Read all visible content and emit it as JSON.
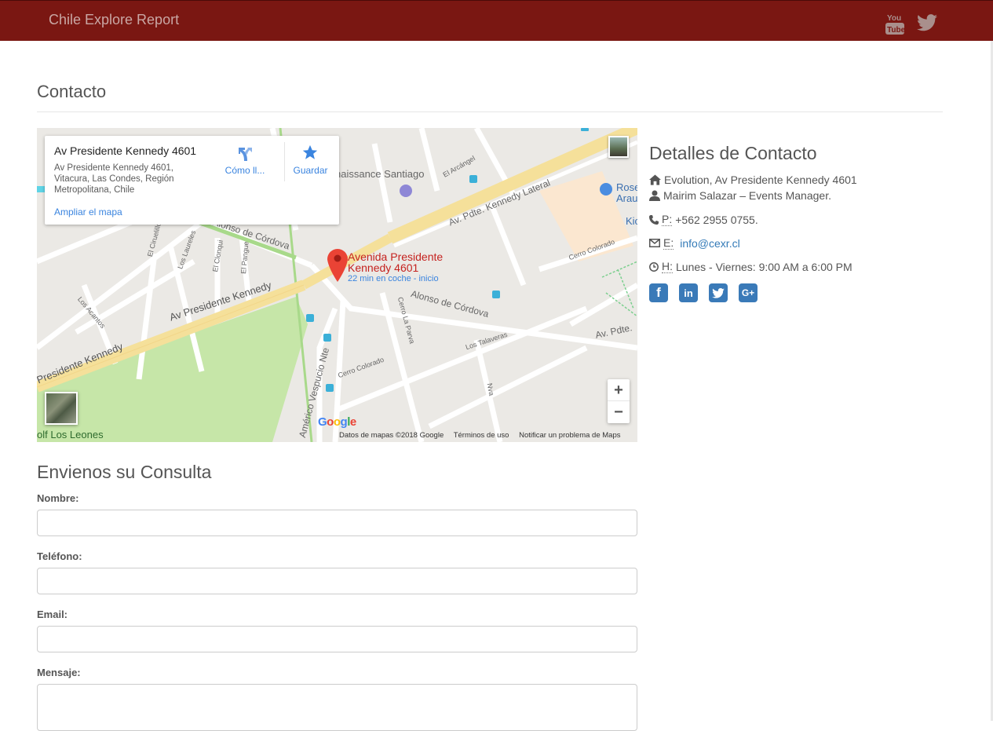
{
  "header": {
    "brand": "Chile Explore Report",
    "icons": [
      "youtube-icon",
      "twitter-icon"
    ]
  },
  "page": {
    "title": "Contacto"
  },
  "map": {
    "info_title": "Av Presidente Kennedy 4601",
    "info_address": "Av Presidente Kennedy 4601, Vitacura, Las Condes, Región Metropolitana, Chile",
    "directions_label": "Cómo ll...",
    "save_label": "Guardar",
    "enlarge_link": "Ampliar el mapa",
    "pin_label_line1": "Avenida Presidente",
    "pin_label_line2": "Kennedy 4601",
    "pin_sub": "22 min en coche - inicio",
    "zoom_in": "+",
    "zoom_out": "−",
    "google": "Google",
    "footer_data": "Datos de mapas ©2018 Google",
    "footer_terms": "Términos de uso",
    "footer_report": "Notificar un problema de Maps",
    "streets": {
      "kennedy_main": "Av Presidente Kennedy",
      "kennedy_left": "Presidente Kennedy",
      "kennedy_lateral": "Av. Pdte. Kennedy Lateral",
      "alonso_1": "Alonso de Córdova",
      "alonso_2": "Alonso de Córdova",
      "cerro_colorado_1": "Cerro Colorado",
      "cerro_colorado_2": "Cerro Colorado",
      "los_talaveras": "Los Talaveras",
      "cerro_la_parva": "Cerro La Parva",
      "americo": "Américo Vespucio Nte",
      "el_arcangel": "El Arcángel",
      "renaissance": "naissance Santiago",
      "los_laureles": "Los Laureles",
      "el_cirueillo": "El Ciruelillo",
      "el_clonqui": "El Clonqui",
      "el_pangue": "El Pangue",
      "los_acantos": "Los Acantos",
      "av_pdte": "Av. Pdte.",
      "golf": "olf Los Leones",
      "nva": "Nva",
      "rose": "Rose",
      "arau": "Arau",
      "kio": "Kio"
    }
  },
  "contact": {
    "title": "Detalles de Contacto",
    "address": "Evolution, Av Presidente Kennedy 4601",
    "person": "Mairim Salazar – Events Manager.",
    "phone_abbr": "P:",
    "phone": "+562 2955 0755.",
    "email_abbr": "E:",
    "email": "info@cexr.cl",
    "hours_abbr": "H:",
    "hours": "Lunes - Viernes: 9:00 AM a 6:00 PM",
    "social": [
      {
        "name": "facebook",
        "glyph": "f"
      },
      {
        "name": "linkedin",
        "glyph": "in"
      },
      {
        "name": "twitter",
        "glyph": ""
      },
      {
        "name": "google-plus",
        "glyph": "G+"
      }
    ]
  },
  "form": {
    "title": "Envienos su Consulta",
    "name_label": "Nombre:",
    "name_value": "",
    "phone_label": "Teléfono:",
    "phone_value": "",
    "email_label": "Email:",
    "email_value": "",
    "message_label": "Mensaje:",
    "message_value": ""
  },
  "colors": {
    "header_bg": "#7a1712",
    "brand_text": "#c9a7a4",
    "link": "#337ab7",
    "social_bg": "#3a7ab8"
  }
}
